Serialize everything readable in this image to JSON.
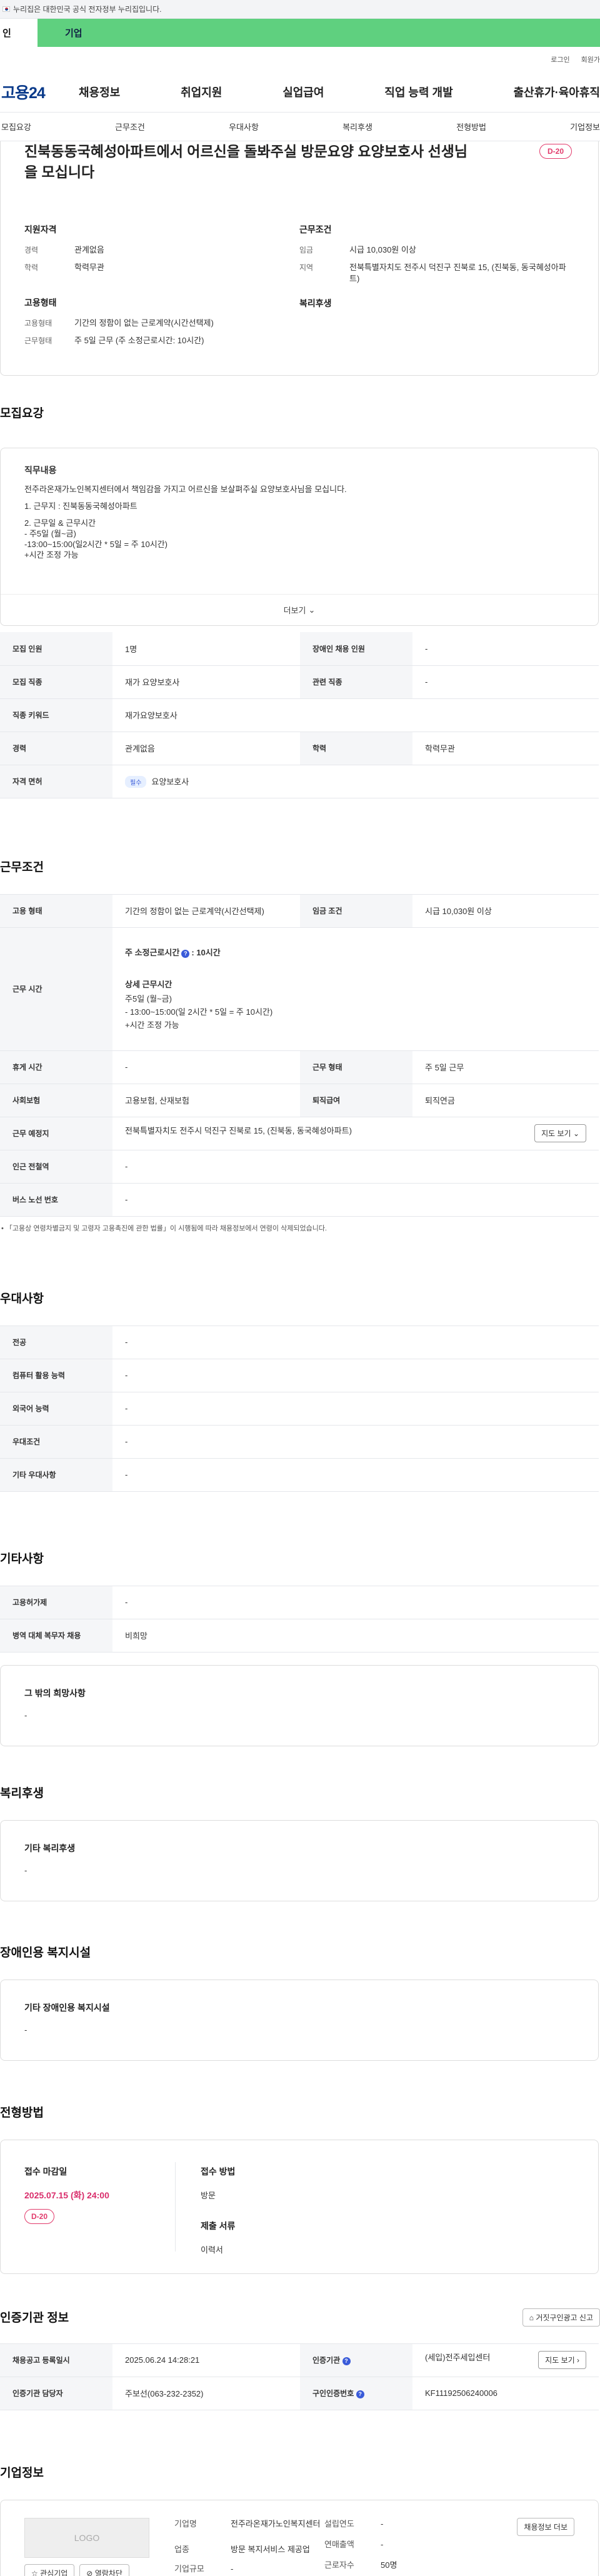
{
  "notice": {
    "text": "누리집은 대한민국 공식 전자정부 누리집입니다."
  },
  "typebar": {
    "personal": "인",
    "company": "기업"
  },
  "toplinks": {
    "login": "로그인",
    "signup": "회원가"
  },
  "gnb": {
    "logo": "고용24",
    "menu": [
      "채용정보",
      "취업지원",
      "실업급여",
      "직업 능력 개발",
      "출산휴가·육아휴직"
    ]
  },
  "tabs": [
    "모집요강",
    "근무조건",
    "우대사항",
    "복리후생",
    "전형방법",
    "기업정보"
  ],
  "hero": {
    "title": "진북동동국혜성아파트에서 어르신을 돌봐주실 방문요양 요양보호사 선생님을 모십니다",
    "dday": "D-20",
    "qual": {
      "heading": "지원자격",
      "rows": [
        {
          "k": "경력",
          "v": "관계없음"
        },
        {
          "k": "학력",
          "v": "학력무관"
        }
      ]
    },
    "cond": {
      "heading": "근무조건",
      "rows": [
        {
          "k": "임금",
          "v": "시급 10,030원 이상"
        },
        {
          "k": "지역",
          "v": "전북특별자치도 전주시 덕진구 진북로 15, (진북동, 동국혜성아파트)"
        }
      ]
    },
    "emp": {
      "heading": "고용형태",
      "rows": [
        {
          "k": "고용형태",
          "v": "기간의 정함이 없는 근로계약(시간선택제)"
        },
        {
          "k": "근무형태",
          "v": "주 5일 근무 (주 소정근로시간: 10시간)"
        }
      ]
    },
    "welfare": {
      "heading": "복리후생"
    }
  },
  "recruit": {
    "title": "모집요강",
    "duty_title": "직무내용",
    "lines": [
      "전주라온재가노인복지센터에서 책임감을 가지고 어르신을 보살펴주실 요양보호사님을 모십니다.",
      "",
      "1. 근무지 : 진북동동국혜성아파트",
      "",
      "2. 근무일 & 근무시간",
      "- 주5일 (월~금)",
      "-13:00~15:00(일2시간 * 5일 = 주 10시간)",
      "+시간 조정 가능"
    ],
    "more": "더보기",
    "table": [
      {
        "k1": "모집 인원",
        "v1": "1명",
        "k2": "장애인 채용 인원",
        "v2": "-"
      },
      {
        "k1": "모집 직종",
        "v1": "재가 요양보호사",
        "k2": "관련 직종",
        "v2": "-"
      },
      {
        "k1": "직종 키워드",
        "v1": "재가요양보호사"
      },
      {
        "k1": "경력",
        "v1": "관계없음",
        "k2": "학력",
        "v2": "학력무관"
      },
      {
        "k1": "자격 면허",
        "badge": "필수",
        "v1": "요양보호사"
      }
    ]
  },
  "work": {
    "title": "근무조건",
    "emp_type_k": "고용 형태",
    "emp_type_v": "기간의 정함이 없는 근로계약(시간선택제)",
    "wage_k": "임금 조건",
    "wage_v": "시급 10,030원 이상",
    "hours_k": "근무 시간",
    "hours_main": "주 소정근로시간",
    "hours_val": ": 10시간",
    "hours_detail_title": "상세 근무시간",
    "hours_detail": [
      "주5일 (월~금)",
      "- 13:00~15:00(일 2시간 * 5일 = 주 10시간)",
      "+시간 조정 가능"
    ],
    "rows": [
      {
        "k1": "휴게 시간",
        "v1": "-",
        "k2": "근무 형태",
        "v2": "주 5일 근무"
      },
      {
        "k1": "사회보험",
        "v1": "고용보험, 산재보험",
        "k2": "퇴직급여",
        "v2": "퇴직연금"
      }
    ],
    "place_k": "근무 예정지",
    "place_v": "전북특별자치도 전주시 덕진구 진북로 15, (진북동, 동국혜성아파트)",
    "map_btn": "지도 보기",
    "subway_k": "인근 전철역",
    "subway_v": "-",
    "bus_k": "버스 노선 번호",
    "bus_v": "-",
    "note": "「고용상 연령차별금지 및 고령자 고용촉진에 관한 법률」이 시행됨에 따라 채용정보에서 연령이 삭제되었습니다."
  },
  "pref": {
    "title": "우대사항",
    "rows": [
      {
        "k": "전공",
        "v": "-"
      },
      {
        "k": "컴퓨터 활용 능력",
        "v": "-"
      },
      {
        "k": "외국어 능력",
        "v": "-"
      },
      {
        "k": "우대조건",
        "v": "-"
      },
      {
        "k": "기타 우대사항",
        "v": "-"
      }
    ]
  },
  "etc": {
    "title": "기타사항",
    "rows": [
      {
        "k": "고용허가제",
        "v": "-"
      },
      {
        "k": "병역 대체 복무자 채용",
        "v": "비희망"
      }
    ],
    "other_title": "그 밖의 희망사항",
    "other_v": "-"
  },
  "welfare": {
    "title": "복리후생",
    "box_title": "기타 복리후생",
    "box_v": "-"
  },
  "disabled": {
    "title": "장애인용 복지시설",
    "box_title": "기타 장애인용 복지시설",
    "box_v": "-"
  },
  "selection": {
    "title": "전형방법",
    "deadline_k": "접수 마감일",
    "deadline_v": "2025.07.15 (화) 24:00",
    "dday": "D-20",
    "method_k": "접수 방법",
    "method_v": "방문",
    "docs_k": "제출 서류",
    "docs_v": "이력서"
  },
  "agency": {
    "title": "인증기관 정보",
    "report_btn": "거짓구인광고 신고",
    "rows": [
      {
        "k1": "채용공고 등록일시",
        "v1": "2025.06.24 14:28:21",
        "k2": "인증기관",
        "v2": "(세입)전주세입센터",
        "btn": "지도 보기"
      },
      {
        "k1": "인증기관 담당자",
        "v1": "주보선(063-232-2352)",
        "k2": "구인인증번호",
        "v2": "KF11192506240006"
      }
    ]
  },
  "company": {
    "title": "기업정보",
    "logo": "LOGO",
    "interest": "관심기업",
    "block": "열람차단",
    "name_k": "기업명",
    "name_v": "전주라온재가노인복지센터",
    "found_k": "설립연도",
    "found_v": "-",
    "sales_k": "연매출액",
    "sales_v": "-",
    "ind_k": "업종",
    "ind_v": "방문 복지서비스 제공업",
    "emp_k": "근로자수",
    "emp_v": "50명",
    "size_k": "기업규모",
    "size_v": "-",
    "jobs_btn": "채용정보 더보"
  }
}
